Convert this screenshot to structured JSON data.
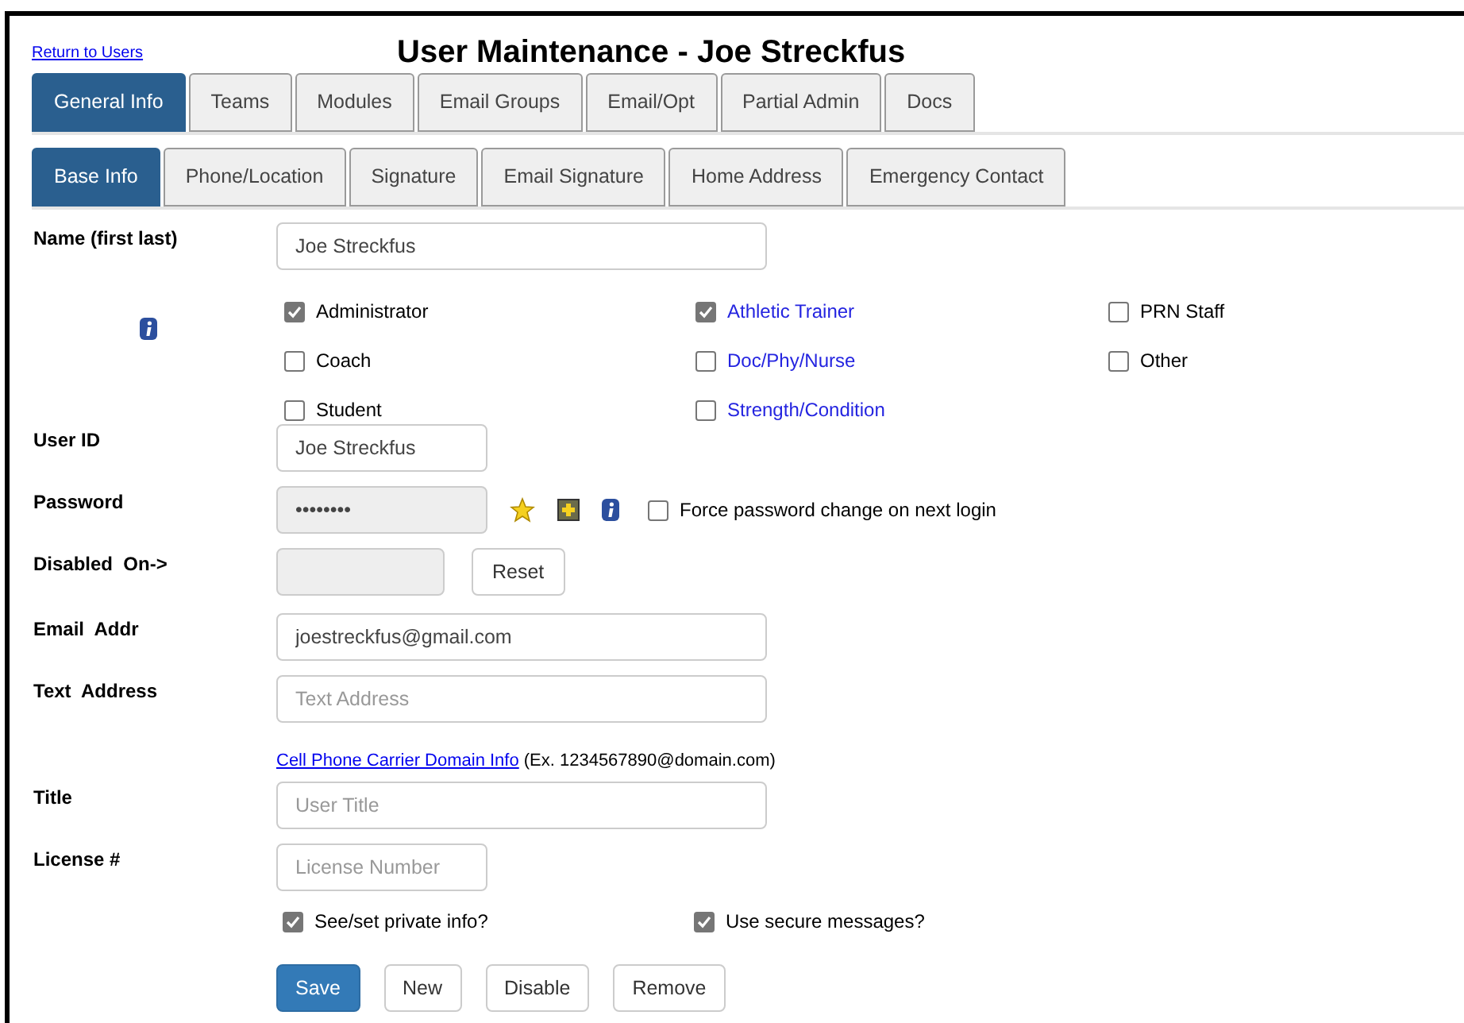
{
  "return_link": "Return to Users",
  "title": "User Maintenance - Joe Streckfus",
  "tabs": [
    {
      "label": "General Info",
      "selected": true
    },
    {
      "label": "Teams",
      "selected": false
    },
    {
      "label": "Modules",
      "selected": false
    },
    {
      "label": "Email Groups",
      "selected": false
    },
    {
      "label": "Email/Opt",
      "selected": false
    },
    {
      "label": "Partial Admin",
      "selected": false
    },
    {
      "label": "Docs",
      "selected": false
    }
  ],
  "subtabs": [
    {
      "label": "Base Info",
      "selected": true
    },
    {
      "label": "Phone/Location",
      "selected": false
    },
    {
      "label": "Signature",
      "selected": false
    },
    {
      "label": "Email Signature",
      "selected": false
    },
    {
      "label": "Home Address",
      "selected": false
    },
    {
      "label": "Emergency Contact",
      "selected": false
    }
  ],
  "name": {
    "label": "Name (first last)",
    "value": "Joe Streckfus"
  },
  "roles": [
    {
      "label": "Administrator",
      "checked": true,
      "kind": "text"
    },
    {
      "label": "Athletic Trainer",
      "checked": true,
      "kind": "link"
    },
    {
      "label": "PRN Staff",
      "checked": false,
      "kind": "text"
    },
    {
      "label": "Coach",
      "checked": false,
      "kind": "text"
    },
    {
      "label": "Doc/Phy/Nurse",
      "checked": false,
      "kind": "link"
    },
    {
      "label": "Other",
      "checked": false,
      "kind": "text"
    },
    {
      "label": "Student",
      "checked": false,
      "kind": "text"
    },
    {
      "label": "Strength/Condition",
      "checked": false,
      "kind": "link"
    }
  ],
  "user_id": {
    "label": "User ID",
    "value": "Joe Streckfus"
  },
  "password": {
    "label": "Password",
    "value": "••••••••",
    "disabled": true
  },
  "force_change": {
    "label": "Force password change on next login",
    "checked": false
  },
  "disabled_on": {
    "label": "Disabled  On->",
    "disabled": true,
    "button": "Reset"
  },
  "email": {
    "label": "Email  Addr",
    "value": "joestreckfus@gmail.com"
  },
  "text_address": {
    "label": "Text  Address",
    "placeholder": "Text Address"
  },
  "carrier_link": "Cell Phone Carrier Domain Info",
  "carrier_example": "(Ex. 1234567890@domain.com)",
  "job_title": {
    "label": "Title",
    "placeholder": "User Title"
  },
  "license": {
    "label": "License #",
    "placeholder": "License Number"
  },
  "options": [
    {
      "label": "See/set private info?",
      "checked": true
    },
    {
      "label": "Use secure messages?",
      "checked": true
    }
  ],
  "buttons": [
    {
      "label": "Save",
      "kind": "primary"
    },
    {
      "label": "New",
      "kind": "default"
    },
    {
      "label": "Disable",
      "kind": "default"
    },
    {
      "label": "Remove",
      "kind": "default"
    }
  ]
}
